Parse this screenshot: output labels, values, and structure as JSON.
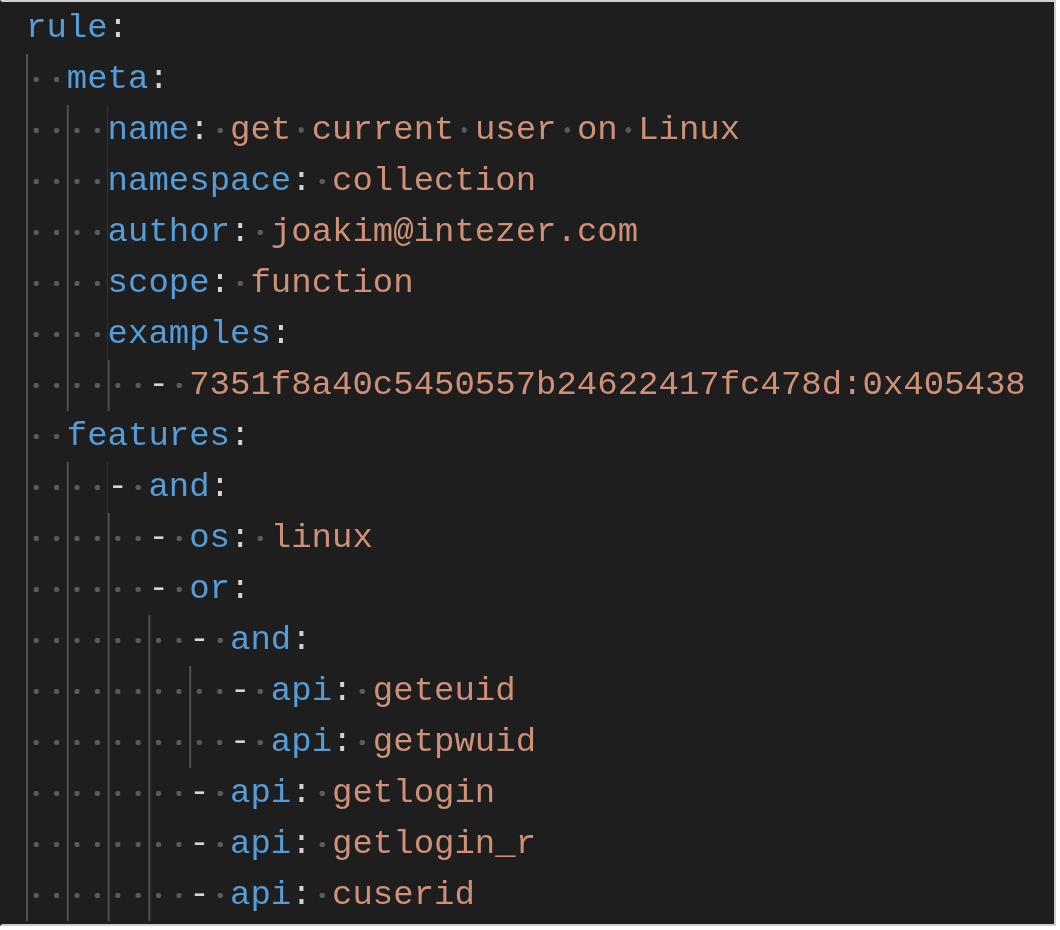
{
  "editor": {
    "lines": [
      {
        "key": "rule",
        "sep": ":",
        "children": [
          {
            "key": "meta",
            "sep": ":",
            "children": [
              {
                "key": "name",
                "sep": ":",
                "value": "get current user on Linux"
              },
              {
                "key": "namespace",
                "sep": ":",
                "value": "collection"
              },
              {
                "key": "author",
                "sep": ":",
                "value": "joakim@intezer.com"
              },
              {
                "key": "scope",
                "sep": ":",
                "value": "function"
              },
              {
                "key": "examples",
                "sep": ":",
                "children": [
                  {
                    "marker": "-",
                    "value": "7351f8a40c5450557b24622417fc478d:0x405438"
                  }
                ]
              }
            ]
          },
          {
            "key": "features",
            "sep": ":",
            "children": [
              {
                "marker": "-",
                "key": "and",
                "sep": ":",
                "children": [
                  {
                    "marker": "-",
                    "key": "os",
                    "sep": ":",
                    "value": "linux"
                  },
                  {
                    "marker": "-",
                    "key": "or",
                    "sep": ":",
                    "children": [
                      {
                        "marker": "-",
                        "key": "and",
                        "sep": ":",
                        "children": [
                          {
                            "marker": "-",
                            "key": "api",
                            "sep": ":",
                            "value": "geteuid"
                          },
                          {
                            "marker": "-",
                            "key": "api",
                            "sep": ":",
                            "value": "getpwuid"
                          }
                        ]
                      },
                      {
                        "marker": "-",
                        "key": "api",
                        "sep": ":",
                        "value": "getlogin"
                      },
                      {
                        "marker": "-",
                        "key": "api",
                        "sep": ":",
                        "value": "getlogin_r"
                      },
                      {
                        "marker": "-",
                        "key": "api",
                        "sep": ":",
                        "value": "cuserid"
                      }
                    ]
                  }
                ]
              }
            ]
          }
        ]
      }
    ]
  }
}
